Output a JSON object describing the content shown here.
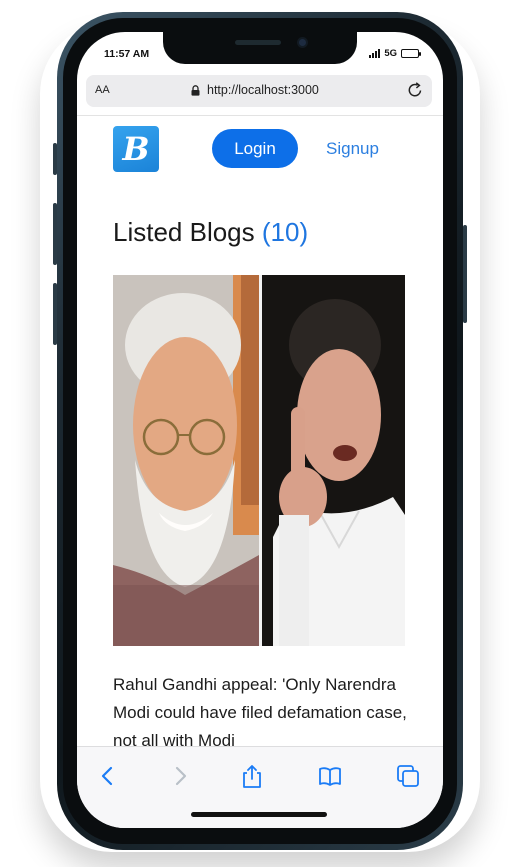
{
  "status_bar": {
    "time": "11:57 AM",
    "network": "5G",
    "signal_icon": "signal-bars-icon",
    "battery_icon": "battery-icon"
  },
  "browser": {
    "text_size_label": "AA",
    "url": "http://localhost:3000",
    "lock_icon": "lock-icon",
    "reload_icon": "reload-icon"
  },
  "nav": {
    "logo_letter": "B",
    "login_label": "Login",
    "signup_label": "Signup"
  },
  "blogs": {
    "heading": "Listed Blogs",
    "count": "(10)",
    "items": [
      {
        "title": "Rahul Gandhi appeal: 'Only Narendra Modi could have filed defamation case, not all with Modi"
      }
    ]
  },
  "toolbar": {
    "back_icon": "chevron-left-icon",
    "forward_icon": "chevron-right-icon",
    "share_icon": "share-icon",
    "bookmarks_icon": "book-icon",
    "tabs_icon": "tabs-icon"
  },
  "colors": {
    "accent": "#0d6fe8",
    "link": "#2c7fe0",
    "logo": "#2a94e6",
    "count": "#1f76e0"
  }
}
